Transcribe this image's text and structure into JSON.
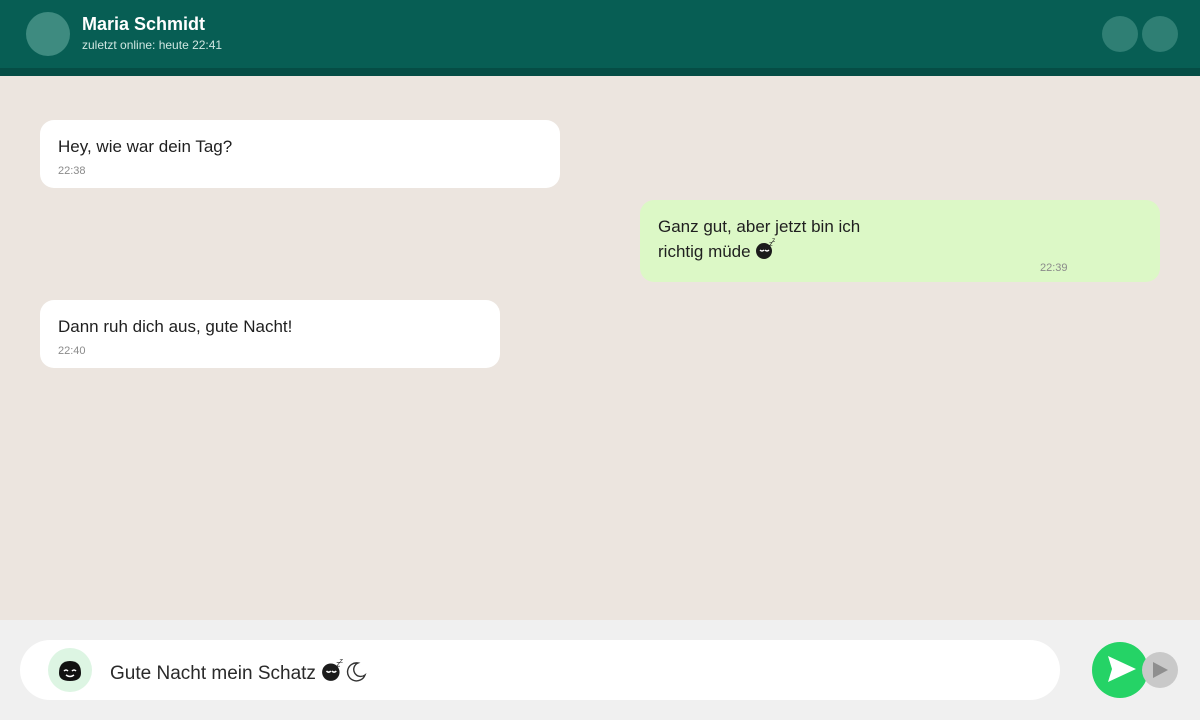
{
  "header": {
    "contact_name": "Maria Schmidt",
    "status": "zuletzt online: heute 22:41"
  },
  "messages": [
    {
      "direction": "in",
      "text": "Hey, wie war dein Tag?",
      "time": "22:38"
    },
    {
      "direction": "out",
      "text": "Ganz gut, aber jetzt bin ich\nrichtig müde",
      "time": "22:39",
      "emoji": "sleeping-face-icon"
    },
    {
      "direction": "in",
      "text": "Dann ruh dich aus, gute Nacht!",
      "time": "22:40"
    }
  ],
  "composer": {
    "value": "Gute Nacht mein Schatz",
    "emojis": [
      "sleeping-face-icon",
      "crescent-moon-icon"
    ],
    "emoji_button_icon": "smiling-face-icon",
    "send_icon": "send-arrow-icon"
  },
  "colors": {
    "header": "#075E54",
    "background": "#ECE5DF",
    "incoming_bubble": "#FFFFFF",
    "outgoing_bubble": "#DCF8C6",
    "send_button": "#25D366"
  }
}
